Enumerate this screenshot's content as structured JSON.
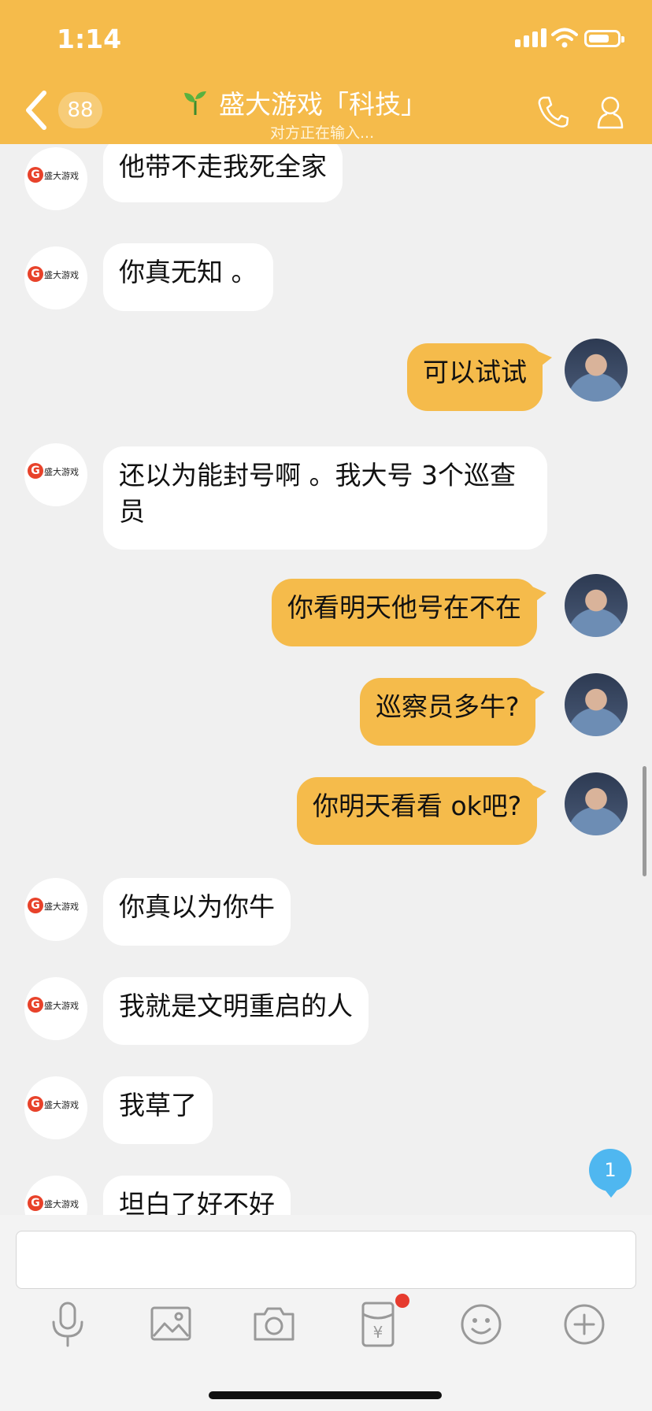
{
  "status_bar": {
    "time": "1:14"
  },
  "header": {
    "back_count": "88",
    "title": "盛大游戏「科技」",
    "subtitle": "对方正在输入..."
  },
  "contact": {
    "avatar_brand": "盛大游戏"
  },
  "messages": [
    {
      "side": "in",
      "text": "他带不走我死全家"
    },
    {
      "side": "in",
      "text": "你真无知 。"
    },
    {
      "side": "out",
      "text": "可以试试"
    },
    {
      "side": "in",
      "text": "还以为能封号啊 。我大号 3个巡查员"
    },
    {
      "side": "out",
      "text": "你看明天他号在不在"
    },
    {
      "side": "out",
      "text": "巡察员多牛?"
    },
    {
      "side": "out",
      "text": "你明天看看 ok吧?"
    },
    {
      "side": "in",
      "text": "你真以为你牛"
    },
    {
      "side": "in",
      "text": "我就是文明重启的人"
    },
    {
      "side": "in",
      "text": "我草了"
    },
    {
      "side": "in",
      "text": "坦白了好不好"
    }
  ],
  "unread_count": "1",
  "toolbar": {
    "icons": [
      "microphone-icon",
      "image-icon",
      "camera-icon",
      "red-packet-icon",
      "emoji-icon",
      "plus-icon"
    ]
  },
  "colors": {
    "accent": "#f5bb4b",
    "background": "#f0f0f0",
    "unread": "#4fb7f0"
  }
}
